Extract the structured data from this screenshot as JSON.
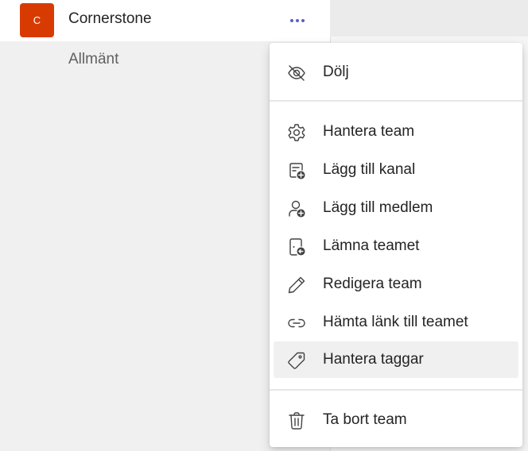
{
  "team": {
    "avatar_letter": "C",
    "avatar_color": "#d83b01",
    "name": "Cornerstone",
    "more_icon": "more-horizontal-icon",
    "channels": [
      "Allmänt"
    ]
  },
  "menu": {
    "items": [
      {
        "label": "Dölj",
        "icon": "eye-off-icon"
      },
      {
        "label": "Hantera team",
        "icon": "gear-icon"
      },
      {
        "label": "Lägg till kanal",
        "icon": "add-channel-icon"
      },
      {
        "label": "Lägg till medlem",
        "icon": "add-person-icon"
      },
      {
        "label": "Lämna teamet",
        "icon": "leave-door-icon"
      },
      {
        "label": "Redigera team",
        "icon": "pencil-icon"
      },
      {
        "label": "Hämta länk till teamet",
        "icon": "link-icon"
      },
      {
        "label": "Hantera taggar",
        "icon": "tag-icon",
        "highlighted": true
      },
      {
        "label": "Ta bort team",
        "icon": "trash-icon"
      }
    ]
  },
  "colors": {
    "accent": "#5b5fc7",
    "highlight": "#f0f0f0"
  }
}
